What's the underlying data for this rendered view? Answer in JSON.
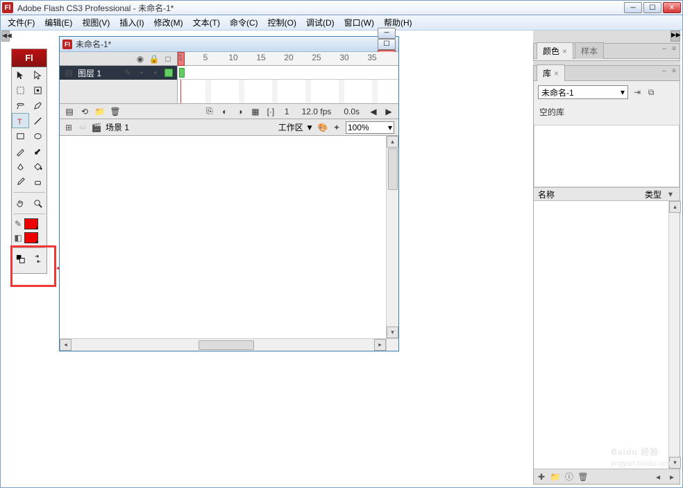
{
  "app": {
    "title": "Adobe Flash CS3 Professional - 未命名-1*",
    "icon_label": "Fl"
  },
  "menubar": [
    "文件(F)",
    "编辑(E)",
    "视图(V)",
    "插入(I)",
    "修改(M)",
    "文本(T)",
    "命令(C)",
    "控制(O)",
    "调试(D)",
    "窗口(W)",
    "帮助(H)"
  ],
  "tools": {
    "header": "Fl",
    "stroke_color": "#ee0000",
    "fill_color": "#ee0000"
  },
  "document": {
    "title": "未命名-1*",
    "layer_name": "图层 1",
    "ruler_marks": [
      "1",
      "5",
      "10",
      "15",
      "20",
      "25",
      "30",
      "35"
    ],
    "current_frame": "1",
    "fps": "12.0 fps",
    "elapsed": "0.0s",
    "scene": "场景 1",
    "workarea_label": "工作区 ▼",
    "zoom": "100%"
  },
  "panels": {
    "color_tab": "颜色",
    "swatch_tab": "样本",
    "library_tab": "库",
    "library_doc": "未命名-1",
    "library_empty": "空的库",
    "col_name": "名称",
    "col_type": "类型"
  },
  "watermark": {
    "brand": "Baidu 经验",
    "sub": "jingyan.baidu.com"
  }
}
